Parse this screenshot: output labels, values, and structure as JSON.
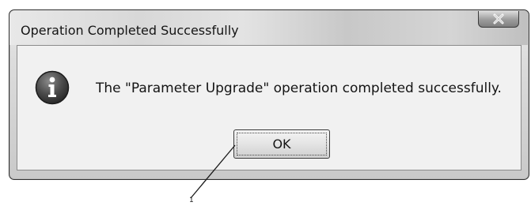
{
  "dialog": {
    "title": "Operation Completed Successfully",
    "close_label": "x",
    "message": "The \"Parameter Upgrade\" operation completed successfully.",
    "icon": "information-icon",
    "ok_label": "OK"
  },
  "annotation": {
    "callout_number": "1"
  }
}
